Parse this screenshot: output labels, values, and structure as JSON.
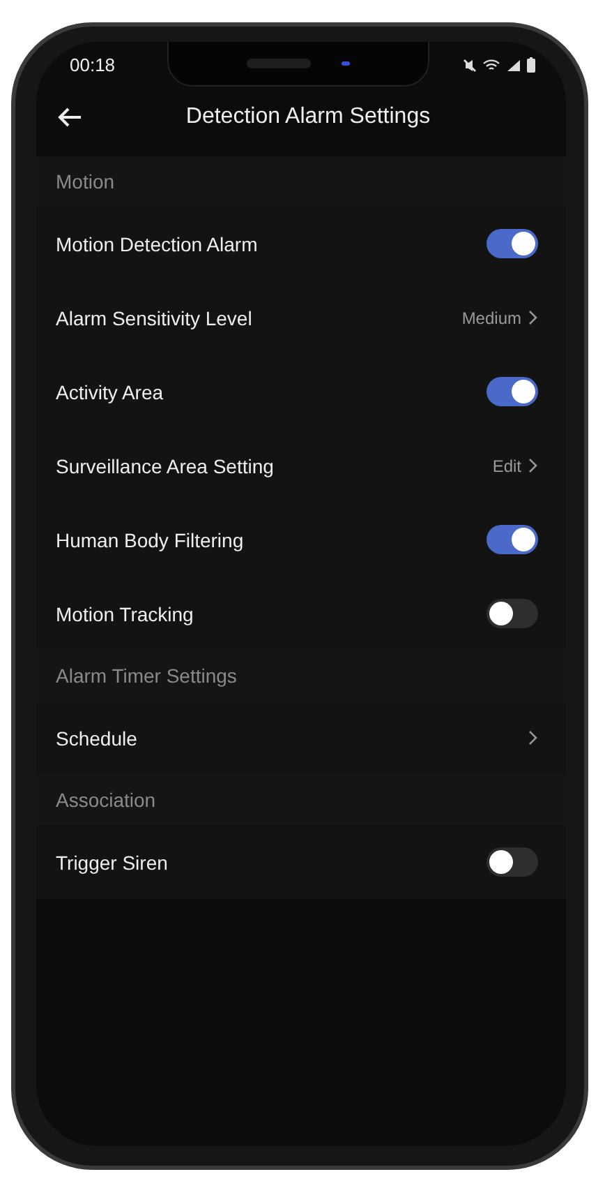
{
  "status_bar": {
    "time": "00:18"
  },
  "header": {
    "title": "Detection Alarm Settings"
  },
  "sections": [
    {
      "title": "Motion",
      "items": [
        {
          "kind": "toggle",
          "label": "Motion Detection Alarm",
          "on": true
        },
        {
          "kind": "value",
          "label": "Alarm Sensitivity Level",
          "value": "Medium"
        },
        {
          "kind": "toggle",
          "label": "Activity Area",
          "on": true
        },
        {
          "kind": "value",
          "label": "Surveillance Area Setting",
          "value": "Edit"
        },
        {
          "kind": "toggle",
          "label": "Human Body Filtering",
          "on": true
        },
        {
          "kind": "toggle",
          "label": "Motion Tracking",
          "on": false
        }
      ]
    },
    {
      "title": "Alarm Timer Settings",
      "items": [
        {
          "kind": "link",
          "label": "Schedule"
        }
      ]
    },
    {
      "title": "Association",
      "items": [
        {
          "kind": "toggle",
          "label": "Trigger Siren",
          "on": false
        }
      ]
    }
  ]
}
